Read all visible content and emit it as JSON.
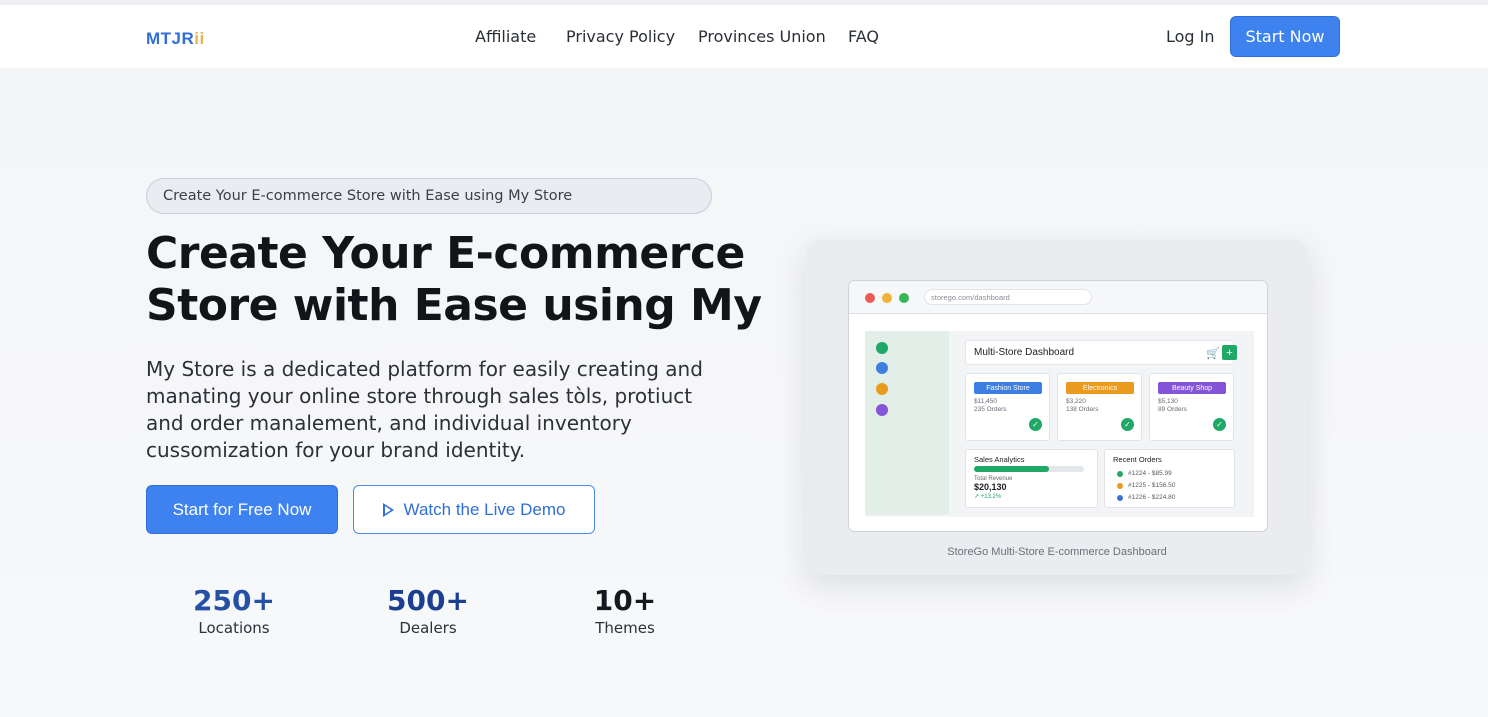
{
  "nav": {
    "logo_main": "MTJR",
    "logo_accent": "ii",
    "links": [
      "Affiliate",
      "Privacy Policy",
      "Provinces Union",
      "FAQ"
    ],
    "login_label": "Log In",
    "start_label": "Start Now"
  },
  "hero": {
    "pill_text": "Create Your E-commerce Store with Ease using My Store",
    "headline_line1": "Create Your E-commerce",
    "headline_line2": "Store with Ease using My",
    "description": "My Store is a dedicated platform for easily creating and manating your online store through sales tòls, protiuct and order manalement, and individual inventory cussomization for your brand identity.",
    "primary_button": "Start for Free Now",
    "secondary_button": "Watch the Live Demo",
    "play_icon": "play-icon"
  },
  "stats": [
    {
      "value": "250+",
      "label": "Locations",
      "color": "#2451a6"
    },
    {
      "value": "500+",
      "label": "Dealers",
      "color": "#1d3f8f"
    },
    {
      "value": "10+",
      "label": "Themes",
      "color": "#15191f"
    }
  ],
  "preview": {
    "url": "storego.com/dashboard",
    "dashboard_title": "Multi-Store Dashboard",
    "cart_icon": "cart-icon",
    "plus_label": "+",
    "stores": [
      {
        "name": "Fashion Store",
        "revenue": "$11,450",
        "orders": "235 Orders",
        "color": "#3d7fe0"
      },
      {
        "name": "Electronics",
        "revenue": "$3,220",
        "orders": "138 Orders",
        "color": "#ea9a1f"
      },
      {
        "name": "Beauty Shop",
        "revenue": "$5,130",
        "orders": "89 Orders",
        "color": "#8454d9"
      }
    ],
    "analytics": {
      "title": "Sales Analytics",
      "progress": 0.68,
      "revenue_label": "Total Revenue",
      "revenue_value": "$20,130",
      "change": "↗ +13.2%"
    },
    "recent": {
      "title": "Recent Orders",
      "orders": [
        {
          "text": "#1224 - $85.99",
          "color": "#1fa866"
        },
        {
          "text": "#1225 - $156.50",
          "color": "#ea9a1f"
        },
        {
          "text": "#1226 - $224.80",
          "color": "#3d6fd6"
        }
      ]
    },
    "caption": "StoreGo Multi-Store E-commerce Dashboard"
  },
  "colors": {
    "accent": "#3d82ef",
    "green": "#1fa866"
  }
}
